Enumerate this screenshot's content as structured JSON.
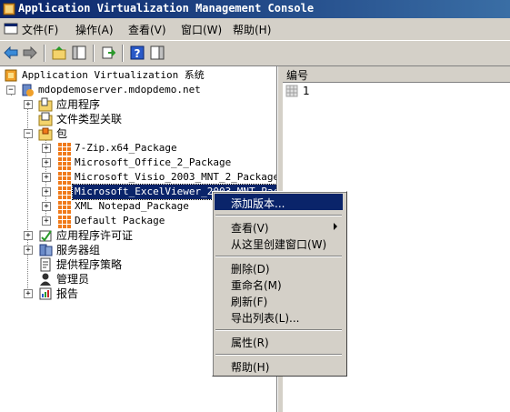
{
  "window": {
    "title": "Application Virtualization Management Console"
  },
  "menu": [
    "文件(F)",
    "操作(A)",
    "查看(V)",
    "窗口(W)",
    "帮助(H)"
  ],
  "tree": {
    "root": "Application Virtualization 系统",
    "server": "mdopdemoserver.mdopdemo.net",
    "items": [
      "应用程序",
      "文件类型关联",
      "包",
      "应用程序许可证",
      "服务器组",
      "提供程序策略",
      "管理员",
      "报告"
    ],
    "packages": [
      "7-Zip.x64_Package",
      "Microsoft_Office_2_Package",
      "Microsoft_Visio_2003_MNT_2_Package",
      "Microsoft_ExcelViewer_2003_MNT_Pack",
      "XML Notepad_Package",
      "Default Package"
    ]
  },
  "list": {
    "column": "编号",
    "rows": [
      "1"
    ]
  },
  "context_menu": {
    "items": [
      "添加版本...",
      "查看(V)",
      "从这里创建窗口(W)",
      "删除(D)",
      "重命名(M)",
      "刷新(F)",
      "导出列表(L)...",
      "属性(R)",
      "帮助(H)"
    ]
  },
  "colors": {
    "title_start": "#0a246a",
    "title_end": "#3a6ea5",
    "selection": "#0a246a",
    "package_icon": "#f07a1a"
  }
}
